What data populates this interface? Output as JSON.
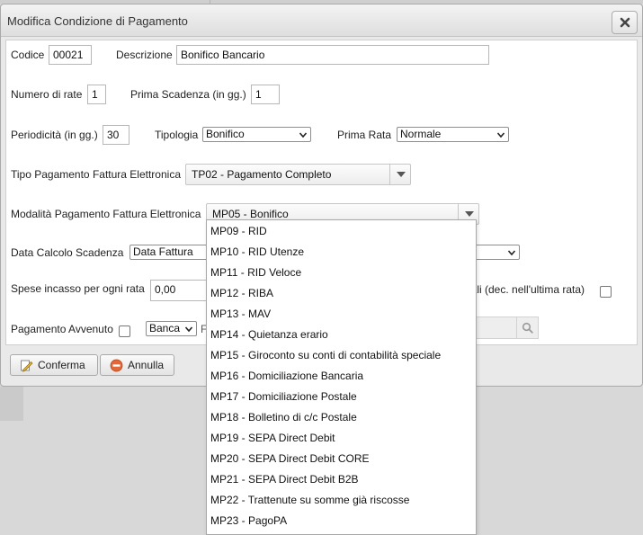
{
  "dialog": {
    "title": "Modifica Condizione di Pagamento"
  },
  "form": {
    "codice_label": "Codice",
    "codice_value": "00021",
    "descrizione_label": "Descrizione",
    "descrizione_value": "Bonifico Bancario",
    "numero_rate_label": "Numero di rate",
    "numero_rate_value": "1",
    "prima_scadenza_label": "Prima Scadenza (in gg.)",
    "prima_scadenza_value": "1",
    "periodicita_label": "Periodicità (in gg.)",
    "periodicita_value": "30",
    "tipologia_label": "Tipologia",
    "tipologia_value": "Bonifico",
    "prima_rata_label": "Prima Rata",
    "prima_rata_value": "Normale",
    "tipo_pagamento_label": "Tipo Pagamento Fattura Elettronica",
    "tipo_pagamento_value": "TP02 - Pagamento Completo",
    "modalita_pagamento_label": "Modalità Pagamento Fattura Elettronica",
    "modalita_pagamento_value": "MP05 - Bonifico",
    "data_calcolo_label": "Data Calcolo Scadenza",
    "data_calcolo_value": "Data Fattura",
    "spese_incasso_label": "Spese incasso per ogni rata",
    "spese_incasso_value": "0,00",
    "decimali_label": "nali (dec. nell'ultima rata)",
    "pagamento_avvenuto_label": "Pagamento Avvenuto",
    "banca_value": "Banca",
    "hidden_char": "F"
  },
  "buttons": {
    "conferma": "Conferma",
    "annulla": "Annulla"
  },
  "dropdown_options": [
    "MP09 - RID",
    "MP10 - RID Utenze",
    "MP11 - RID Veloce",
    "MP12 - RIBA",
    "MP13 - MAV",
    "MP14 - Quietanza erario",
    "MP15 - Giroconto su conti di contabilità speciale",
    "MP16 - Domiciliazione Bancaria",
    "MP17 - Domiciliazione Postale",
    "MP18 - Bolletino di c/c Postale",
    "MP19 - SEPA Direct Debit",
    "MP20 - SEPA Direct Debit CORE",
    "MP21 - SEPA Direct Debit B2B",
    "MP22 - Trattenute su somme già riscosse",
    "MP23 - PagoPA"
  ],
  "icons": {
    "close": "close-icon",
    "conferma": "edit-icon",
    "annulla": "cancel-icon",
    "search": "search-icon"
  },
  "colors": {
    "cancel_icon": "#e0683a",
    "dialog_bg": "#e9e9e9"
  }
}
